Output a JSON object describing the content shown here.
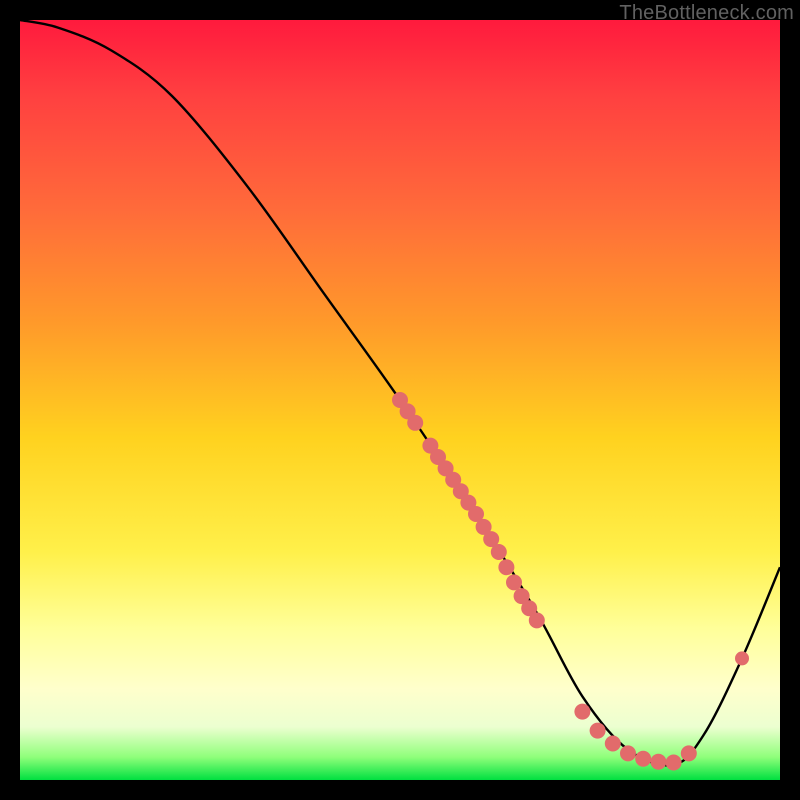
{
  "watermark": "TheBottleneck.com",
  "chart_data": {
    "type": "line",
    "title": "",
    "xlabel": "",
    "ylabel": "",
    "xlim": [
      0,
      100
    ],
    "ylim": [
      0,
      100
    ],
    "curve": {
      "name": "bottleneck-curve",
      "x": [
        0,
        5,
        12,
        20,
        30,
        40,
        50,
        60,
        68,
        74,
        80,
        86,
        90,
        95,
        100
      ],
      "y": [
        100,
        99,
        96,
        90,
        78,
        64,
        50,
        35,
        22,
        11,
        4,
        2,
        6,
        16,
        28
      ]
    },
    "dot_clusters": [
      {
        "name": "cluster-upper",
        "color": "#e26b6b",
        "radius": 8,
        "points": [
          {
            "x": 50,
            "y": 50
          },
          {
            "x": 51,
            "y": 48.5
          },
          {
            "x": 52,
            "y": 47
          },
          {
            "x": 54,
            "y": 44
          },
          {
            "x": 55,
            "y": 42.5
          },
          {
            "x": 56,
            "y": 41
          },
          {
            "x": 57,
            "y": 39.5
          },
          {
            "x": 58,
            "y": 38
          },
          {
            "x": 59,
            "y": 36.5
          },
          {
            "x": 60,
            "y": 35
          },
          {
            "x": 61,
            "y": 33.3
          },
          {
            "x": 62,
            "y": 31.7
          },
          {
            "x": 63,
            "y": 30
          },
          {
            "x": 64,
            "y": 28
          },
          {
            "x": 65,
            "y": 26
          },
          {
            "x": 66,
            "y": 24.2
          },
          {
            "x": 67,
            "y": 22.6
          },
          {
            "x": 68,
            "y": 21
          }
        ]
      },
      {
        "name": "cluster-bottom",
        "color": "#e26b6b",
        "radius": 8,
        "points": [
          {
            "x": 74,
            "y": 9
          },
          {
            "x": 76,
            "y": 6.5
          },
          {
            "x": 78,
            "y": 4.8
          },
          {
            "x": 80,
            "y": 3.5
          },
          {
            "x": 82,
            "y": 2.8
          },
          {
            "x": 84,
            "y": 2.4
          },
          {
            "x": 86,
            "y": 2.3
          },
          {
            "x": 88,
            "y": 3.5
          }
        ]
      },
      {
        "name": "cluster-right",
        "color": "#e26b6b",
        "radius": 7,
        "points": [
          {
            "x": 95,
            "y": 16
          }
        ]
      }
    ]
  }
}
